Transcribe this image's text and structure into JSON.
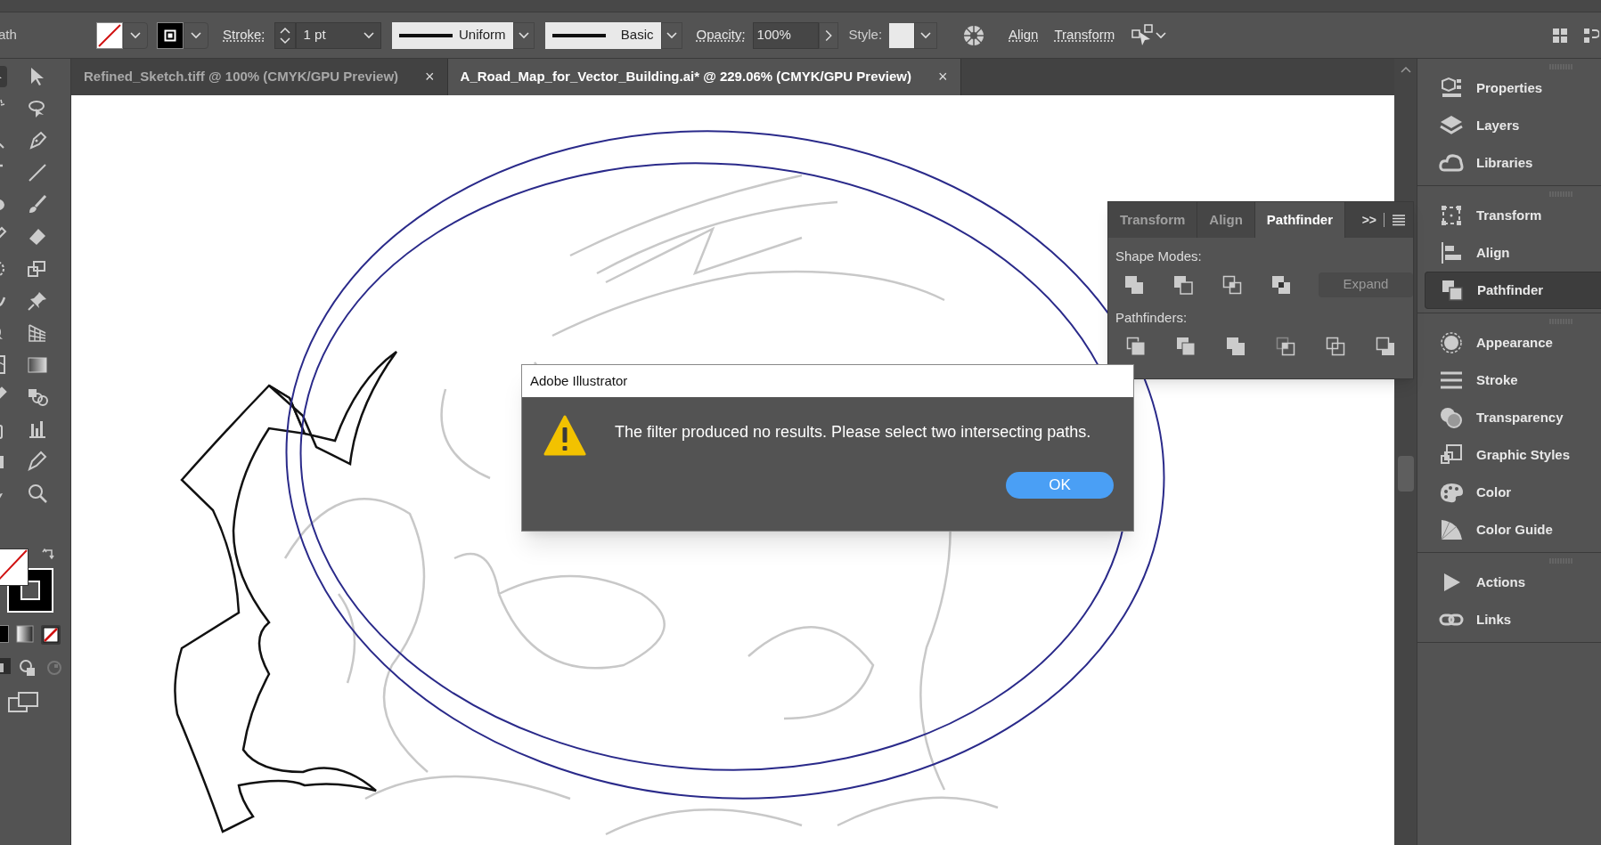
{
  "control_bar": {
    "object_type": "ath",
    "stroke_label": "Stroke:",
    "stroke_weight": "1 pt",
    "profile": "Uniform",
    "brush": "Basic",
    "opacity_label": "Opacity:",
    "opacity": "100%",
    "style_label": "Style:",
    "align": "Align",
    "transform": "Transform"
  },
  "document_tabs": [
    {
      "title": "Refined_Sketch.tiff @ 100% (CMYK/GPU Preview)",
      "close": "×",
      "selected": false
    },
    {
      "title": "A_Road_Map_for_Vector_Building.ai* @ 229.06% (CMYK/GPU Preview)",
      "close": "×",
      "selected": true
    }
  ],
  "pathfinder_panel": {
    "tabs": [
      {
        "label": "Transform",
        "selected": false
      },
      {
        "label": "Align",
        "selected": false
      },
      {
        "label": "Pathfinder",
        "selected": true
      }
    ],
    "overflow": ">>",
    "shape_modes_label": "Shape Modes:",
    "expand_button": {
      "label": "Expand",
      "disabled": true
    },
    "pathfinders_label": "Pathfinders:"
  },
  "dialog": {
    "title": "Adobe Illustrator",
    "message": "The filter produced no results. Please select two intersecting paths.",
    "ok": "OK"
  },
  "panel_dock": {
    "groups": [
      {
        "items": [
          {
            "label": "Properties",
            "selected": false
          },
          {
            "label": "Layers",
            "selected": false
          },
          {
            "label": "Libraries",
            "selected": false
          }
        ]
      },
      {
        "items": [
          {
            "label": "Transform",
            "selected": false
          },
          {
            "label": "Align",
            "selected": false
          },
          {
            "label": "Pathfinder",
            "selected": true
          }
        ]
      },
      {
        "items": [
          {
            "label": "Appearance",
            "selected": false
          },
          {
            "label": "Stroke",
            "selected": false
          },
          {
            "label": "Transparency",
            "selected": false
          },
          {
            "label": "Graphic Styles",
            "selected": false
          },
          {
            "label": "Color",
            "selected": false
          },
          {
            "label": "Color Guide",
            "selected": false
          }
        ]
      },
      {
        "items": [
          {
            "label": "Actions",
            "selected": false
          },
          {
            "label": "Links",
            "selected": false
          }
        ]
      }
    ]
  }
}
